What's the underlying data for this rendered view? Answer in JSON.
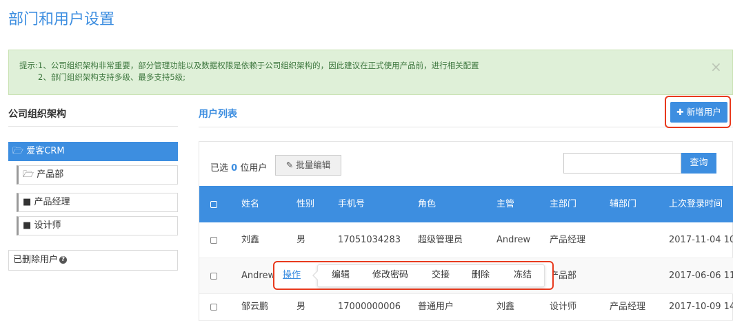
{
  "page_title": "部门和用户设置",
  "alert": {
    "line1": "提示:1、公司组织架构非常重要，部分管理功能以及数据权限是依赖于公司组织架构的，因此建议在正式使用产品前，进行相关配置",
    "line2": "2、部门组织架构支持多级、最多支持5级;",
    "close": "×"
  },
  "sidebar": {
    "title": "公司组织架构",
    "root": "爱客CRM",
    "children": [
      "产品部",
      "产品经理",
      "设计师"
    ],
    "deleted_users": "已删除用户"
  },
  "main": {
    "title": "用户列表",
    "add_button": "新增用户",
    "selected_prefix": "已选",
    "selected_count": "0",
    "selected_suffix": "位用户",
    "batch_edit": "批量编辑",
    "search_placeholder": "",
    "search_button": "查询"
  },
  "table": {
    "headers": [
      "姓名",
      "性别",
      "手机号",
      "角色",
      "主管",
      "主部门",
      "辅部门",
      "上次登录时间"
    ],
    "rows": [
      {
        "name": "刘鑫",
        "gender": "男",
        "phone": "17051034283",
        "role": "超级管理员",
        "manager": "Andrew",
        "dept": "产品经理",
        "sub_dept": "",
        "last_login": "2017-11-04 10"
      },
      {
        "name": "Andrew",
        "gender": "",
        "phone": "",
        "role": "",
        "manager": "",
        "dept": "产品部",
        "sub_dept": "",
        "last_login": "2017-06-06 11"
      },
      {
        "name": "邹云鹏",
        "gender": "男",
        "phone": "17000000006",
        "role": "普通用户",
        "manager": "刘鑫",
        "dept": "设计师",
        "sub_dept": "产品经理",
        "last_login": "2017-10-09 14"
      }
    ]
  },
  "action_menu": {
    "trigger": "操作",
    "items": [
      "编辑",
      "修改密码",
      "交接",
      "删除",
      "冻结"
    ]
  },
  "colors": {
    "primary": "#3d8ee0",
    "alert_bg": "#dff0d8",
    "highlight": "#e8391d"
  }
}
